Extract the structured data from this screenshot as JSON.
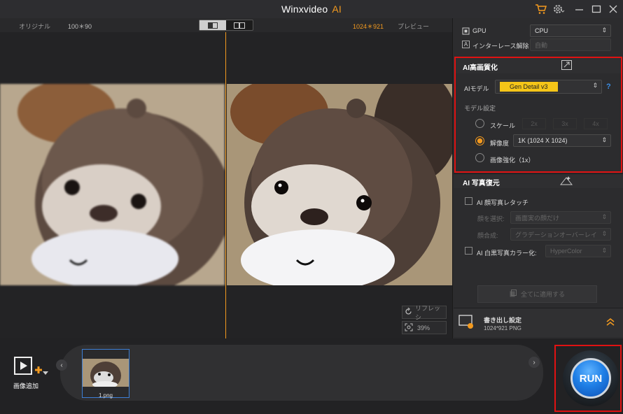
{
  "app": {
    "title": "Winxvideo",
    "title_ai": "AI"
  },
  "viewer": {
    "original_label": "オリジナル",
    "original_resolution": "100＊90",
    "preview_resolution": "1024＊921",
    "preview_label": "プレビュー",
    "refresh_label": "リフレッシ",
    "zoom": "39%"
  },
  "settings": {
    "gpu_label": "GPU",
    "gpu_value": "CPU",
    "deinterlace_label": "インターレース解除",
    "deinterlace_value": "自動"
  },
  "enhance": {
    "title": "AI高画質化",
    "model_label": "AIモデル",
    "model_value": "Gen Detail v3",
    "help": "?",
    "model_settings_label": "モデル設定",
    "scale_label": "スケール",
    "scale_options": [
      "2x",
      "3x",
      "4x"
    ],
    "resolution_label": "解像度",
    "resolution_value": "1K (1024 X 1024)",
    "image_enhance_label": "画像強化（1x）"
  },
  "restore": {
    "title": "AI 写真復元",
    "face_retouch_label": "AI 顔写真レタッチ",
    "face_select_label": "顔を選択:",
    "face_select_value": "画面実の顔だけ",
    "face_blend_label": "顔合成:",
    "face_blend_value": "グラデーションオーバーレイ",
    "colorize_label": "AI 白黒写真カラー化:",
    "colorize_value": "HyperColor",
    "apply_all_label": "全てに適用する"
  },
  "export": {
    "label": "書き出し設定",
    "info": "1024*921  PNG"
  },
  "bottom": {
    "add_image_label": "画像追加",
    "thumb_name": "1.png",
    "run_label": "RUN"
  },
  "colors": {
    "accent": "#f39a1f",
    "highlight_box": "#e01212",
    "model_badge": "#f5c518",
    "help_link": "#3b8fe8"
  }
}
